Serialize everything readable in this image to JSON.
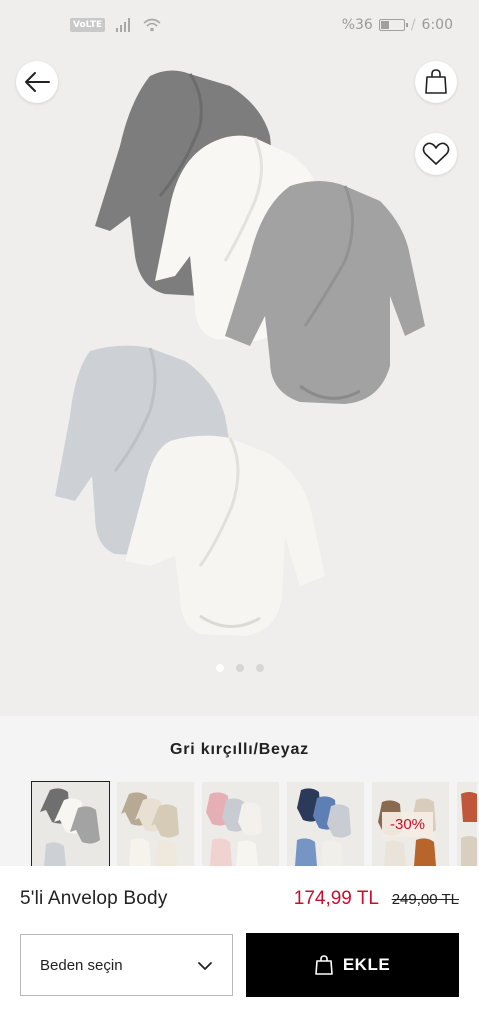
{
  "status_bar": {
    "network_badge": "VoLTE",
    "battery_text": "%36",
    "battery_percent": 36,
    "time": "6:00",
    "icons": [
      "signal-icon",
      "wifi-icon",
      "battery-icon"
    ]
  },
  "header": {
    "icons": [
      "arrow-left-icon",
      "shopping-bag-icon",
      "heart-icon"
    ]
  },
  "gallery": {
    "slide_count": 3,
    "active_slide": 1
  },
  "product": {
    "color_name": "Gri kırçıllı/Beyaz",
    "swatches": [
      {
        "id": "gray-white",
        "selected": true
      },
      {
        "id": "beige",
        "selected": false
      },
      {
        "id": "pink",
        "selected": false
      },
      {
        "id": "blue",
        "selected": false
      },
      {
        "id": "brown",
        "selected": false,
        "badge": "-30%"
      },
      {
        "id": "more",
        "selected": false
      }
    ],
    "name": "5'li Anvelop Body",
    "price_current": "174,99 TL",
    "price_old": "249,00 TL",
    "sale_color": "#c8102e"
  },
  "actions": {
    "size_placeholder": "Beden seçin",
    "add_label": "EKLE"
  }
}
